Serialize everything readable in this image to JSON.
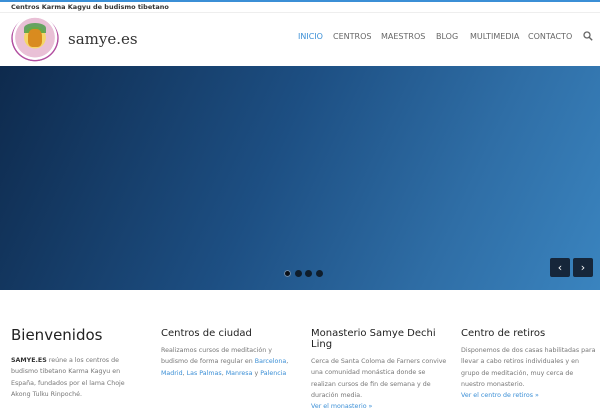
{
  "topbar": {
    "text": "Centros Karma Kagyu de budismo tibetano"
  },
  "header": {
    "brand": "samye.es",
    "nav": [
      "INICIO",
      "CENTROS",
      "MAESTROS",
      "BLOG",
      "MULTIMEDIA",
      "CONTACTO"
    ],
    "active_index": 0
  },
  "slider": {
    "dots": 4,
    "active_dot": 0,
    "prev": "‹",
    "next": "›"
  },
  "columns": {
    "welcome": {
      "title": "Bienvenidos",
      "strong": "SAMYE.ES",
      "text": " reúne a los centros de budismo tibetano Karma Kagyu en España, fundados por el lama Choje Akong Tulku Rinpoché."
    },
    "city": {
      "title": "Centros de ciudad",
      "text": "Realizamos cursos de meditación y budismo de forma regular en ",
      "links": [
        "Barcelona",
        "Madrid",
        "Las Palmas",
        "Manresa",
        "Palencia"
      ],
      "conj": "y"
    },
    "monastery": {
      "title": "Monasterio Samye Dechi Ling",
      "text": "Cerca de Santa Coloma de Farners convive una comunidad monástica donde se realizan cursos de fin de semana y de duración media.",
      "link": "Ver el monasterio »"
    },
    "retreat": {
      "title": "Centro de retiros",
      "text": "Disponemos de dos casas habilitadas para llevar a cabo retiros individuales y en grupo de meditación, muy cerca de nuestro monasterio.",
      "link": "Ver el centro de retiros »"
    }
  },
  "colors": {
    "accent": "#3b8fd6",
    "slider_dark": "#0e2a4d",
    "slider_light": "#3a84bf"
  },
  "icons": {
    "search": "search-icon",
    "prev": "chevron-left-icon",
    "next": "chevron-right-icon"
  }
}
